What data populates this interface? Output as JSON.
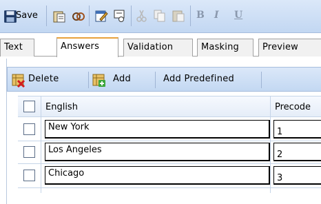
{
  "toolbar": {
    "save_label": "Save",
    "bold_label": "B",
    "italic_label": "I",
    "underline_label": "U"
  },
  "tabs": [
    {
      "label": "Text",
      "active": false
    },
    {
      "label": "Answers",
      "active": true
    },
    {
      "label": "Validation",
      "active": false
    },
    {
      "label": "Masking",
      "active": false
    },
    {
      "label": "Preview",
      "active": false
    }
  ],
  "answers_toolbar": {
    "delete_label": "Delete",
    "add_label": "Add",
    "add_predefined_label": "Add Predefined"
  },
  "grid": {
    "columns": [
      "English",
      "Precode"
    ],
    "rows": [
      {
        "english": "New York",
        "precode": "1"
      },
      {
        "english": "Los Angeles",
        "precode": "2"
      },
      {
        "english": "Chicago",
        "precode": "3"
      }
    ]
  },
  "colors": {
    "toolbar_bg": "#c9dcf4",
    "active_tab_accent": "#e8a13a",
    "border": "#a0a0a0"
  }
}
